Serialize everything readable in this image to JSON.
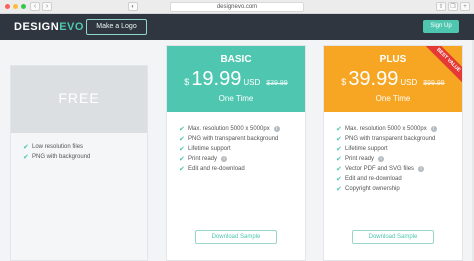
{
  "browser": {
    "url": "designevo.com"
  },
  "header": {
    "logo_design": "DESIGN",
    "logo_evo": "EVO",
    "make_logo": "Make a Logo",
    "signup": "Sign Up"
  },
  "plans": {
    "free": {
      "name": "FREE",
      "features": [
        {
          "text": "Low resolution files"
        },
        {
          "text": "PNG with background"
        }
      ]
    },
    "basic": {
      "name": "BASIC",
      "currency": "$",
      "price": "19.99",
      "unit": "USD",
      "old_price": "$39.99",
      "term": "One Time",
      "features": [
        {
          "text": "Max. resolution 5000 x 5000px",
          "info": true
        },
        {
          "text": "PNG with transparent background"
        },
        {
          "text": "Lifetime support"
        },
        {
          "text": "Print ready",
          "info": true
        },
        {
          "text": "Edit and re-download"
        }
      ],
      "cta": "Download Sample"
    },
    "plus": {
      "name": "PLUS",
      "ribbon": "BEST VALUE",
      "currency": "$",
      "price": "39.99",
      "unit": "USD",
      "old_price": "$99.99",
      "term": "One Time",
      "features": [
        {
          "text": "Max. resolution 5000 x 5000px",
          "info": true
        },
        {
          "text": "PNG with transparent background"
        },
        {
          "text": "Lifetime support"
        },
        {
          "text": "Print ready",
          "info": true
        },
        {
          "text": "Vector PDF and SVG files",
          "info": true
        },
        {
          "text": "Edit and re-download"
        },
        {
          "text": "Copyright ownership"
        }
      ],
      "cta": "Download Sample"
    }
  },
  "icons": {
    "check": "check-icon",
    "info": "info-icon"
  },
  "colors": {
    "header_bg": "#2f3640",
    "accent": "#4fc7b0",
    "plus_orange": "#f6a623",
    "ribbon_red": "#e53935"
  }
}
